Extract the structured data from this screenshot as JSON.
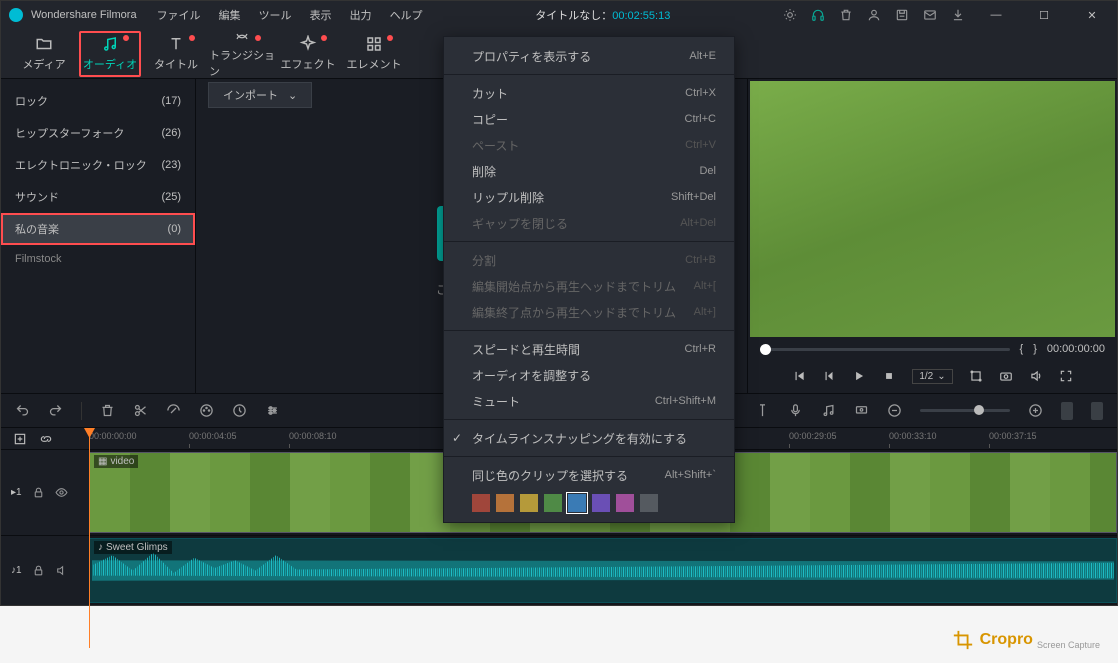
{
  "app_name": "Wondershare Filmora",
  "menus": [
    "ファイル",
    "編集",
    "ツール",
    "表示",
    "出力",
    "ヘルプ"
  ],
  "title_prefix": "タイトルなし：",
  "title_duration": "00:02:55:13",
  "tools": [
    {
      "id": "media",
      "label": "メディア",
      "dot": false
    },
    {
      "id": "audio",
      "label": "オーディオ",
      "dot": true,
      "active": true
    },
    {
      "id": "title",
      "label": "タイトル",
      "dot": true
    },
    {
      "id": "transition",
      "label": "トランジション",
      "dot": true
    },
    {
      "id": "effect",
      "label": "エフェクト",
      "dot": true
    },
    {
      "id": "element",
      "label": "エレメント",
      "dot": true
    }
  ],
  "sidebar": [
    {
      "label": "ロック",
      "count": "(17)"
    },
    {
      "label": "ヒップスターフォーク",
      "count": "(26)"
    },
    {
      "label": "エレクトロニック・ロック",
      "count": "(23)"
    },
    {
      "label": "サウンド",
      "count": "(25)"
    },
    {
      "label": "私の音楽",
      "count": "(0)",
      "sel": true,
      "hl": true
    }
  ],
  "sidebar_footer": "Filmstock",
  "import_label": "インポート",
  "drop_text": "ここにメディ",
  "preview": {
    "braces_l": "{",
    "braces_r": "}",
    "time": "00:00:00:00",
    "scale": "1/2"
  },
  "ruler": [
    "00:00:00:00",
    "00:00:04:05",
    "00:00:08:10",
    "00:00:29:05",
    "00:00:33:10",
    "00:00:37:15"
  ],
  "ruler_pos": [
    0,
    100,
    200,
    700,
    800,
    900
  ],
  "video_clip": "video",
  "audio_clip": "Sweet Glimps",
  "track_v": "1",
  "track_a": "1",
  "ctx": {
    "props": {
      "label": "プロパティを表示する",
      "short": "Alt+E"
    },
    "cut": {
      "label": "カット",
      "short": "Ctrl+X"
    },
    "copy": {
      "label": "コピー",
      "short": "Ctrl+C"
    },
    "paste": {
      "label": "ペースト",
      "short": "Ctrl+V"
    },
    "del": {
      "label": "削除",
      "short": "Del"
    },
    "ripdel": {
      "label": "リップル削除",
      "short": "Shift+Del"
    },
    "gap": {
      "label": "ギャップを閉じる",
      "short": "Alt+Del"
    },
    "split": {
      "label": "分割",
      "short": "Ctrl+B"
    },
    "trim1": {
      "label": "編集開始点から再生ヘッドまでトリム",
      "short": "Alt+["
    },
    "trim2": {
      "label": "編集終了点から再生ヘッドまでトリム",
      "short": "Alt+]"
    },
    "speed": {
      "label": "スピードと再生時間",
      "short": "Ctrl+R"
    },
    "audadj": {
      "label": "オーディオを調整する",
      "short": ""
    },
    "mute": {
      "label": "ミュート",
      "short": "Ctrl+Shift+M"
    },
    "snap": {
      "label": "タイムラインスナッピングを有効にする",
      "short": ""
    },
    "samecolor": {
      "label": "同じ色のクリップを選択する",
      "short": "Alt+Shift+`"
    }
  },
  "ctx_colors": [
    "#a0463b",
    "#b5723a",
    "#b59a3a",
    "#4f8a46",
    "#3a7bb5",
    "#6a4fb5",
    "#a04f9a",
    "#555a60"
  ],
  "ctx_color_sel": 4,
  "watermark": "Cropro",
  "watermark_sub": "Screen Capture"
}
